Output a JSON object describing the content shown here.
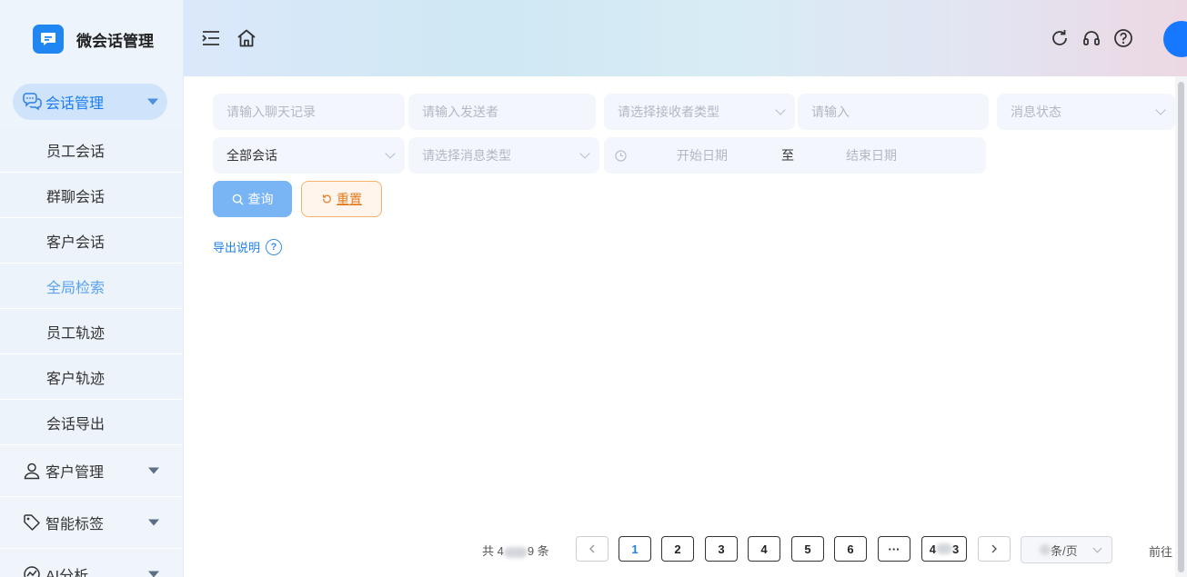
{
  "app": {
    "title": "微会话管理"
  },
  "sidebar": {
    "active_group": {
      "label": "会话管理"
    },
    "submenu": [
      {
        "label": "员工会话"
      },
      {
        "label": "群聊会话"
      },
      {
        "label": "客户会话"
      },
      {
        "label": "全局检索"
      },
      {
        "label": "员工轨迹"
      },
      {
        "label": "客户轨迹"
      },
      {
        "label": "会话导出"
      }
    ],
    "groups": [
      {
        "label": "客户管理"
      },
      {
        "label": "智能标签"
      },
      {
        "label": "AI分析"
      }
    ]
  },
  "filters": {
    "chat_record_placeholder": "请输入聊天记录",
    "sender_placeholder": "请输入发送者",
    "receiver_type_placeholder": "请选择接收者类型",
    "input_placeholder": "请输入",
    "message_status_placeholder": "消息状态",
    "session_scope_value": "全部会话",
    "message_type_placeholder": "请选择消息类型",
    "start_date_placeholder": "开始日期",
    "date_separator": "至",
    "end_date_placeholder": "结束日期"
  },
  "actions": {
    "query_label": "查询",
    "reset_label": "重置"
  },
  "export": {
    "link_label": "导出说明",
    "help_glyph": "?"
  },
  "pagination": {
    "total_prefix": "共 4",
    "total_suffix": "9 条",
    "pages": [
      "1",
      "2",
      "3",
      "4",
      "5",
      "6",
      "···"
    ],
    "last_page_prefix": "4",
    "last_page_suffix": "3",
    "page_size_suffix": "条/页",
    "goto_label": "前往",
    "current_page": 1
  },
  "colors": {
    "accent": "#1677ff",
    "sidebar_active_text": "#1a7cf0",
    "reset_border": "#f3b26a"
  }
}
